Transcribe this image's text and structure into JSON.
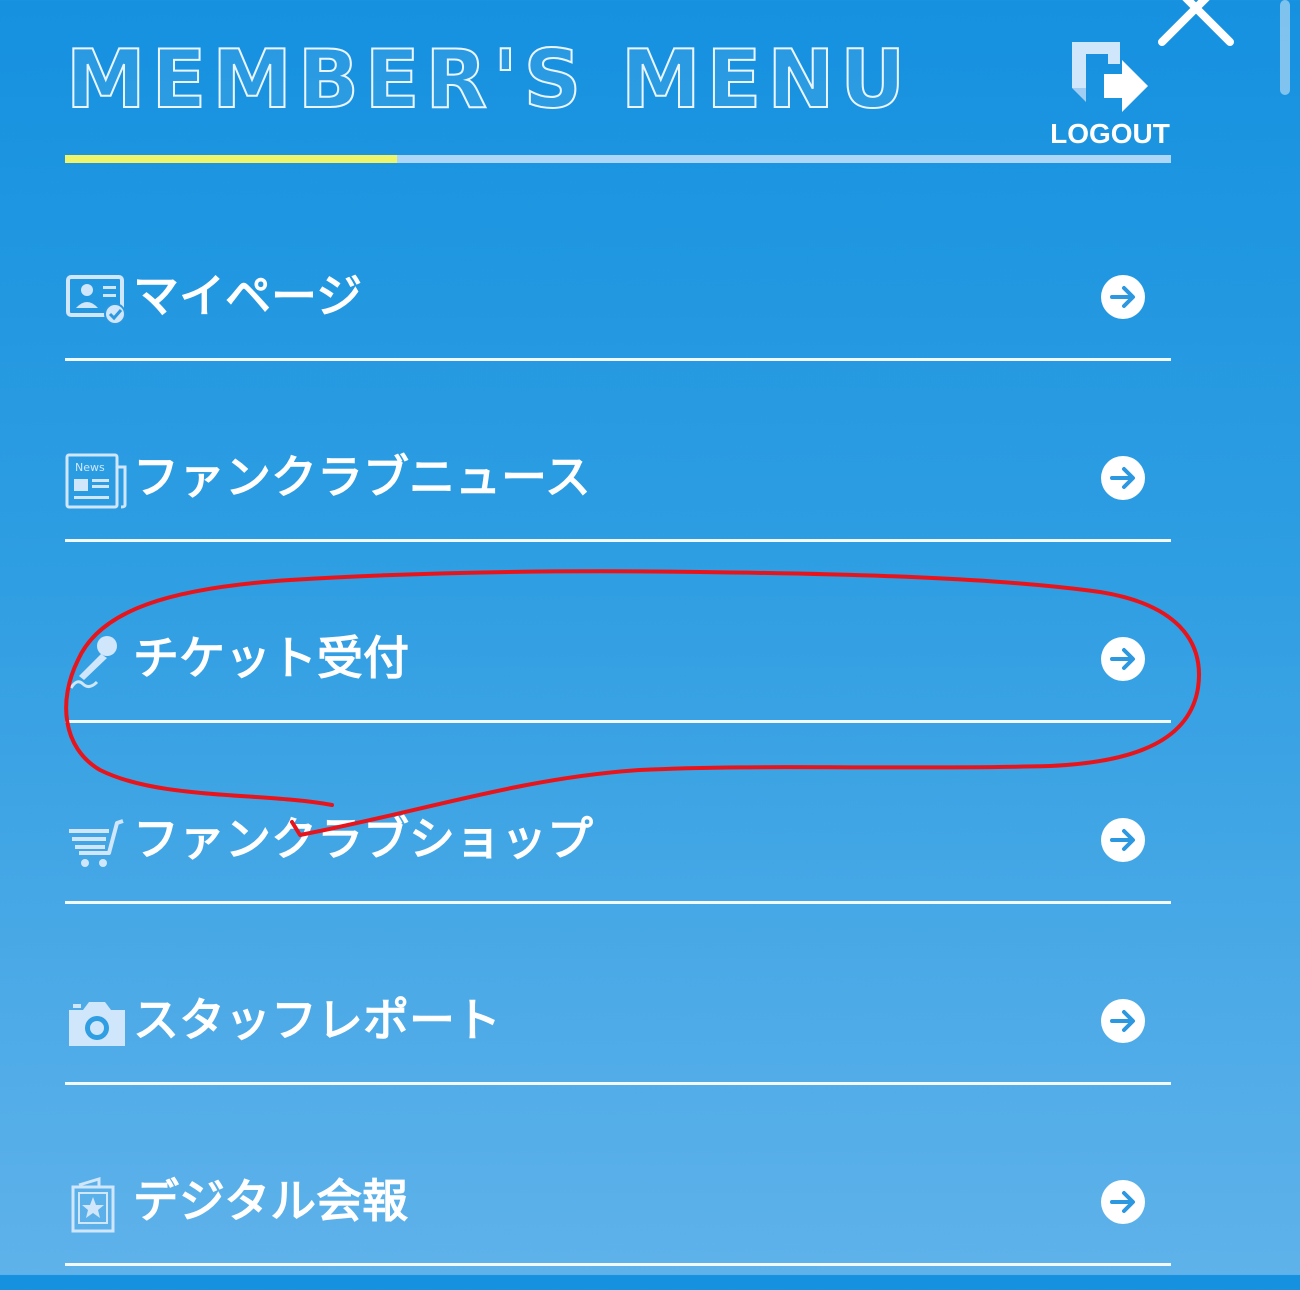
{
  "header": {
    "title": "MEMBER'S MENU",
    "logout_label": "LOGOUT",
    "accent_color": "#eef56a",
    "title_outline_color": "#eaf5ff"
  },
  "menu": {
    "items": [
      {
        "label": "マイページ",
        "icon": "member-card-icon"
      },
      {
        "label": "ファンクラブニュース",
        "icon": "newspaper-icon"
      },
      {
        "label": "チケット受付",
        "icon": "microphone-icon"
      },
      {
        "label": "ファンクラブショップ",
        "icon": "cart-icon"
      },
      {
        "label": "スタッフレポート",
        "icon": "camera-icon"
      },
      {
        "label": "デジタル会報",
        "icon": "bulletin-icon"
      }
    ]
  },
  "annotation": {
    "color": "#e8141c",
    "highlighted_item": "チケット受付"
  },
  "colors": {
    "background_top": "#1591e0",
    "background_bottom": "#5fb2ea",
    "icon_color": "#cfe6fb"
  }
}
